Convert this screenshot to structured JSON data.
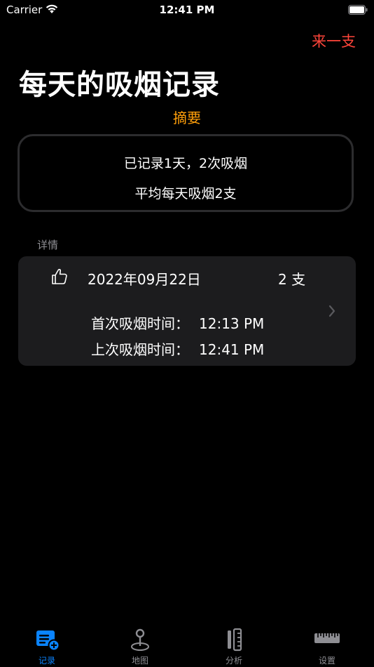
{
  "status_bar": {
    "carrier": "Carrier",
    "time": "12:41 PM"
  },
  "nav": {
    "action_label": "来一支"
  },
  "title": "每天的吸烟记录",
  "summary": {
    "header": "摘要",
    "line1": "已记录1天，2次吸烟",
    "line2": "平均每天吸烟2支"
  },
  "details": {
    "header": "详情",
    "rows": [
      {
        "date": "2022年09月22日",
        "count": "2 支",
        "first_label": "首次吸烟时间：",
        "first_time": "12:13 PM",
        "last_label": "上次吸烟时间：",
        "last_time": "12:41 PM"
      }
    ]
  },
  "tabs": [
    {
      "label": "记录",
      "icon": "records-icon",
      "active": true
    },
    {
      "label": "地图",
      "icon": "map-pin-icon",
      "active": false
    },
    {
      "label": "分析",
      "icon": "analysis-icon",
      "active": false
    },
    {
      "label": "设置",
      "icon": "ruler-icon",
      "active": false
    }
  ],
  "colors": {
    "accent_red": "#ff453a",
    "accent_orange": "#ff9f0a",
    "active_tab": "#0a84ff",
    "inactive_tab": "#8e8e93"
  }
}
